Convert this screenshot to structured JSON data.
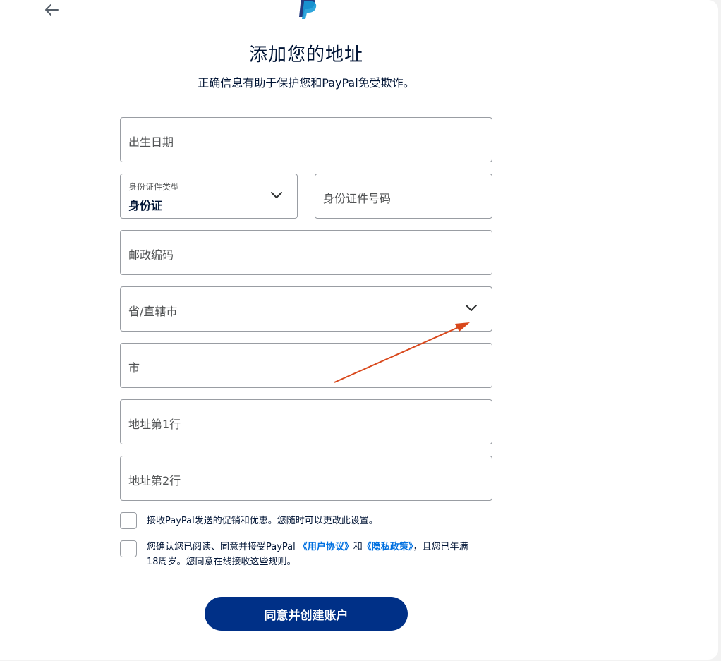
{
  "header": {
    "back_icon": "arrow-left-icon",
    "logo_icon": "paypal-logo-icon"
  },
  "title": "添加您的地址",
  "subtitle": "正确信息有助于保护您和PayPal免受欺诈。",
  "form": {
    "dob_placeholder": "出生日期",
    "id_type_label": "身份证件类型",
    "id_type_value": "身份证",
    "id_number_placeholder": "身份证件号码",
    "postal_code_placeholder": "邮政编码",
    "province_placeholder": "省/直辖市",
    "city_placeholder": "市",
    "address_line1_placeholder": "地址第1行",
    "address_line2_placeholder": "地址第2行"
  },
  "consent": {
    "marketing_text": "接收PayPal发送的促销和优惠。您随时可以更改此设置。",
    "terms_prefix": "您确认您已阅读、同意并接受PayPal ",
    "user_agreement_link": "《用户协议》",
    "and_text": "和",
    "privacy_link": "《隐私政策》",
    "terms_suffix": "，且您已年满",
    "terms_line2": "18周岁。您同意在线接收这些规则。"
  },
  "submit_label": "同意并创建账户",
  "colors": {
    "button_bg": "#003087",
    "link": "#0070e0",
    "annotation_arrow": "#d9481c"
  }
}
